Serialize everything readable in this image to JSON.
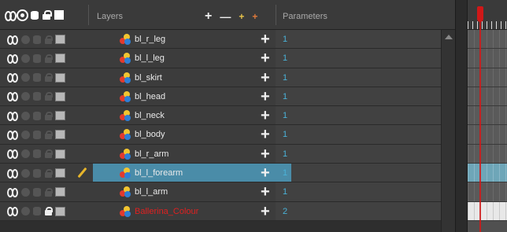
{
  "header": {
    "layers_title": "Layers",
    "parameters_title": "Parameters",
    "tools": {
      "add": "+",
      "remove": "—",
      "add_peg": "+",
      "add_group": "+"
    }
  },
  "layers": [
    {
      "name": "bl_r_leg",
      "param": "1",
      "locked": false,
      "selected": false,
      "color": ""
    },
    {
      "name": "bl_l_leg",
      "param": "1",
      "locked": false,
      "selected": false,
      "color": ""
    },
    {
      "name": "bl_skirt",
      "param": "1",
      "locked": false,
      "selected": false,
      "color": ""
    },
    {
      "name": "bl_head",
      "param": "1",
      "locked": false,
      "selected": false,
      "color": ""
    },
    {
      "name": "bl_neck",
      "param": "1",
      "locked": false,
      "selected": false,
      "color": ""
    },
    {
      "name": "bl_body",
      "param": "1",
      "locked": false,
      "selected": false,
      "color": ""
    },
    {
      "name": "bl_r_arm",
      "param": "1",
      "locked": false,
      "selected": false,
      "color": ""
    },
    {
      "name": "bl_l_forearm",
      "param": "1",
      "locked": false,
      "selected": true,
      "color": ""
    },
    {
      "name": "bl_l_arm",
      "param": "1",
      "locked": false,
      "selected": false,
      "color": ""
    },
    {
      "name": "Ballerina_Colour",
      "param": "2",
      "locked": true,
      "selected": false,
      "color": "#e02020"
    }
  ],
  "colors": {
    "selected_row": "#4a8ca8",
    "param_value": "#4ab2d8",
    "playhead": "#d01818"
  }
}
